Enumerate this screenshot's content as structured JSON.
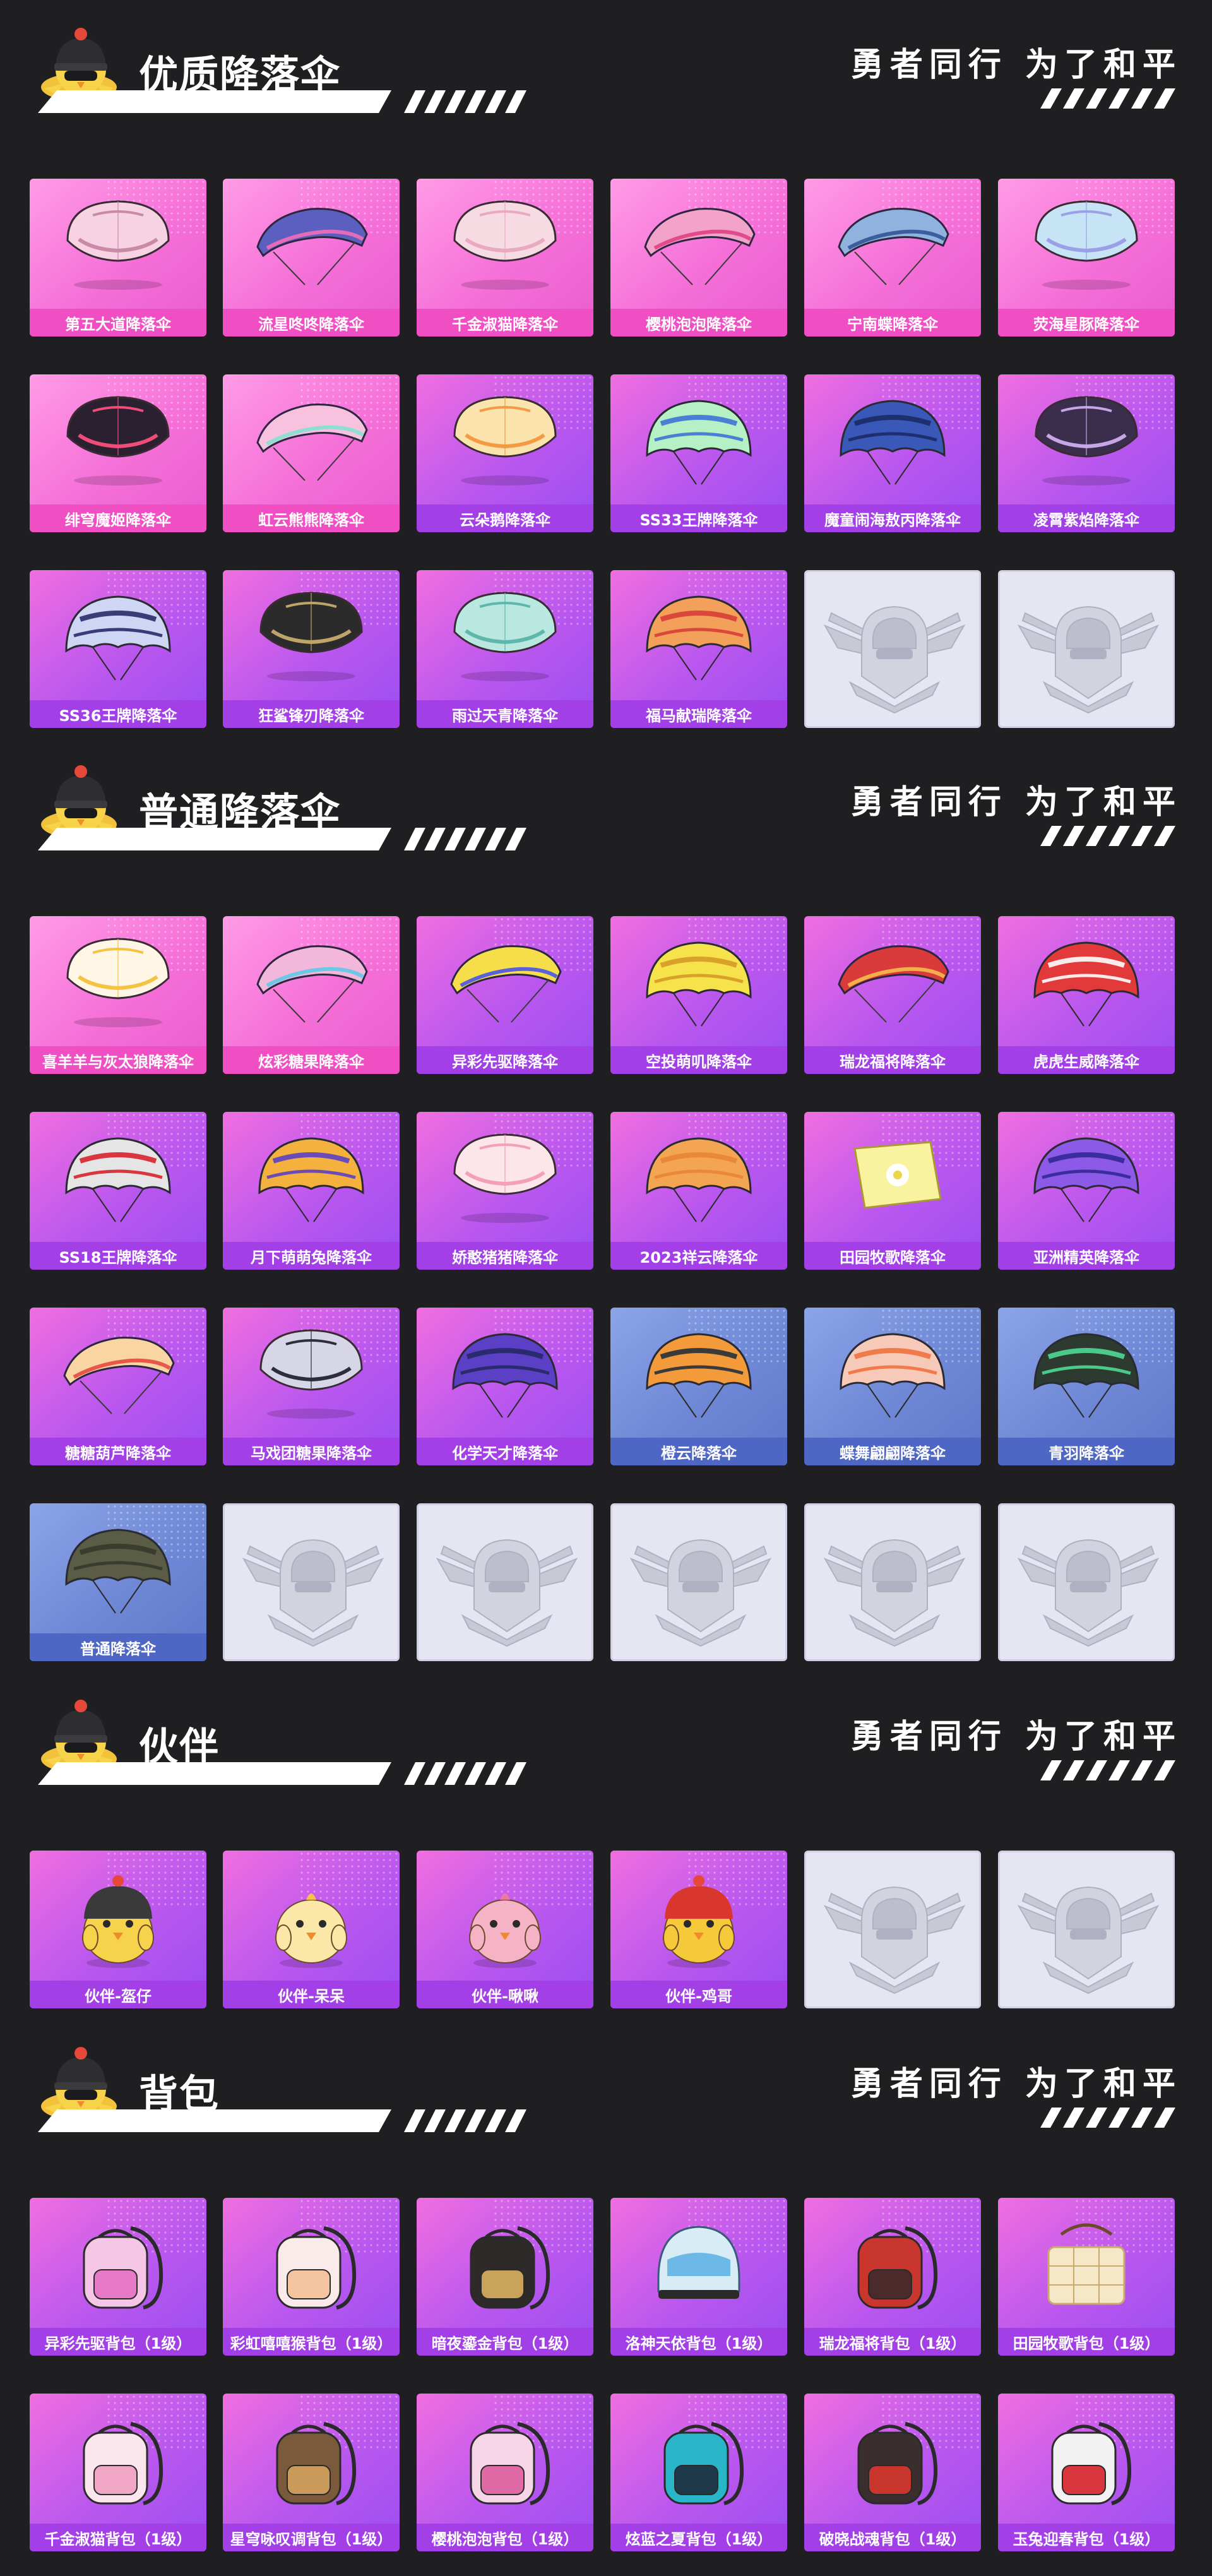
{
  "slogan": "勇者同行 为了和平",
  "sections": [
    {
      "title": "优质降落伞",
      "items": [
        {
          "label": "第五大道降落伞",
          "tier": "pink",
          "kind": "parachute-round",
          "c1": "#f6d2e2",
          "c2": "#c98aa8"
        },
        {
          "label": "流星咚咚降落伞",
          "tier": "pink",
          "kind": "parachute-wing",
          "c1": "#5b5fbf",
          "c2": "#e56bb9"
        },
        {
          "label": "千金淑猫降落伞",
          "tier": "pink",
          "kind": "parachute-round",
          "c1": "#f7dbe3",
          "c2": "#e9a9c0"
        },
        {
          "label": "樱桃泡泡降落伞",
          "tier": "pink",
          "kind": "parachute-wing",
          "c1": "#f3a3c9",
          "c2": "#e14b8b"
        },
        {
          "label": "宁南蝶降落伞",
          "tier": "pink",
          "kind": "parachute-wing",
          "c1": "#8fb3de",
          "c2": "#3d5e9c"
        },
        {
          "label": "荧海星豚降落伞",
          "tier": "pink",
          "kind": "parachute-round",
          "c1": "#c7e3f6",
          "c2": "#9a9fe6"
        },
        {
          "label": "绯穹魔姬降落伞",
          "tier": "pink",
          "kind": "parachute-round",
          "c1": "#2b2030",
          "c2": "#ef4d78"
        },
        {
          "label": "虹云熊熊降落伞",
          "tier": "pink",
          "kind": "parachute-wing",
          "c1": "#f8c2de",
          "c2": "#8edfd3"
        },
        {
          "label": "云朵鹅降落伞",
          "tier": "purple",
          "kind": "parachute-round",
          "c1": "#fbe3ae",
          "c2": "#f49a44"
        },
        {
          "label": "SS33王牌降落伞",
          "tier": "purple",
          "kind": "parachute-dome",
          "c1": "#b5f1c4",
          "c2": "#4b7fd6"
        },
        {
          "label": "魔童闹海敖丙降落伞",
          "tier": "purple",
          "kind": "parachute-dome",
          "c1": "#3a58b8",
          "c2": "#1f2e6e"
        },
        {
          "label": "凌霄紫焰降落伞",
          "tier": "purple",
          "kind": "parachute-round",
          "c1": "#3a2e4c",
          "c2": "#c6a6e6"
        },
        {
          "label": "SS36王牌降落伞",
          "tier": "purple",
          "kind": "parachute-dome",
          "c1": "#cfd6f3",
          "c2": "#3a3c78"
        },
        {
          "label": "狂鲨锋刃降落伞",
          "tier": "purple",
          "kind": "parachute-round",
          "c1": "#2b2b2b",
          "c2": "#bfa46a"
        },
        {
          "label": "雨过天青降落伞",
          "tier": "purple",
          "kind": "parachute-round",
          "c1": "#b8e8e0",
          "c2": "#5fb6ad"
        },
        {
          "label": "福马献瑞降落伞",
          "tier": "purple",
          "kind": "parachute-dome",
          "c1": "#f2a05a",
          "c2": "#d9483a"
        },
        {
          "label": "",
          "tier": "empty",
          "kind": "emblem"
        },
        {
          "label": "",
          "tier": "empty",
          "kind": "emblem"
        }
      ]
    },
    {
      "title": "普通降落伞",
      "items": [
        {
          "label": "喜羊羊与灰太狼降落伞",
          "tier": "pink",
          "kind": "parachute-round",
          "c1": "#fff6e6",
          "c2": "#f4c343"
        },
        {
          "label": "炫彩糖果降落伞",
          "tier": "pink",
          "kind": "parachute-wing",
          "c1": "#f2b7da",
          "c2": "#6cc8e6"
        },
        {
          "label": "异彩先驱降落伞",
          "tier": "purple",
          "kind": "parachute-wing",
          "c1": "#f6de4b",
          "c2": "#5b61d8"
        },
        {
          "label": "空投萌叽降落伞",
          "tier": "purple",
          "kind": "parachute-dome",
          "c1": "#f6e24a",
          "c2": "#d9a12a"
        },
        {
          "label": "瑞龙福将降落伞",
          "tier": "purple",
          "kind": "parachute-wing",
          "c1": "#d93a3a",
          "c2": "#f2b04a"
        },
        {
          "label": "虎虎生威降落伞",
          "tier": "purple",
          "kind": "parachute-dome",
          "c1": "#e23a3a",
          "c2": "#fbeaea"
        },
        {
          "label": "SS18王牌降落伞",
          "tier": "purple",
          "kind": "parachute-dome",
          "c1": "#e5e5e5",
          "c2": "#d9363e"
        },
        {
          "label": "月下萌萌兔降落伞",
          "tier": "purple",
          "kind": "parachute-dome",
          "c1": "#f4b13e",
          "c2": "#6b4bb8"
        },
        {
          "label": "娇憨猪猪降落伞",
          "tier": "purple",
          "kind": "parachute-round",
          "c1": "#fde6ea",
          "c2": "#f3a0b5"
        },
        {
          "label": "2023祥云降落伞",
          "tier": "purple",
          "kind": "parachute-dome",
          "c1": "#f4a552",
          "c2": "#e88838"
        },
        {
          "label": "田园牧歌降落伞",
          "tier": "purple",
          "kind": "parachute-square",
          "c1": "#f9f3a0",
          "c2": "#e9d64a"
        },
        {
          "label": "亚洲精英降落伞",
          "tier": "purple",
          "kind": "parachute-dome",
          "c1": "#8c5ae6",
          "c2": "#3b2d9e"
        },
        {
          "label": "糖糖葫芦降落伞",
          "tier": "purple",
          "kind": "parachute-wing",
          "c1": "#f9d5a3",
          "c2": "#e8574a"
        },
        {
          "label": "马戏团糖果降落伞",
          "tier": "purple",
          "kind": "parachute-round",
          "c1": "#d6d6e6",
          "c2": "#2e2e3a"
        },
        {
          "label": "化学天才降落伞",
          "tier": "purple",
          "kind": "parachute-dome",
          "c1": "#5b3fc4",
          "c2": "#2a2a6e"
        },
        {
          "label": "橙云降落伞",
          "tier": "blue",
          "kind": "parachute-dome",
          "c1": "#f39a3a",
          "c2": "#3a3a3a"
        },
        {
          "label": "蝶舞翩翩降落伞",
          "tier": "blue",
          "kind": "parachute-dome",
          "c1": "#f7c9b8",
          "c2": "#f07a4a"
        },
        {
          "label": "青羽降落伞",
          "tier": "blue",
          "kind": "parachute-dome",
          "c1": "#2c3a30",
          "c2": "#4bc98a"
        },
        {
          "label": "普通降落伞",
          "tier": "blue",
          "kind": "parachute-dome",
          "c1": "#5a5c45",
          "c2": "#3a3c2e"
        },
        {
          "label": "",
          "tier": "empty",
          "kind": "emblem"
        },
        {
          "label": "",
          "tier": "empty",
          "kind": "emblem"
        },
        {
          "label": "",
          "tier": "empty",
          "kind": "emblem"
        },
        {
          "label": "",
          "tier": "empty",
          "kind": "emblem"
        },
        {
          "label": "",
          "tier": "empty",
          "kind": "emblem"
        }
      ]
    },
    {
      "title": "伙伴",
      "items": [
        {
          "label": "伙伴-盔仔",
          "tier": "purple",
          "kind": "chick-helmet",
          "c1": "#f6d34a",
          "c2": "#3a3a3a"
        },
        {
          "label": "伙伴-呆呆",
          "tier": "purple",
          "kind": "chick",
          "c1": "#fbe8a8",
          "c2": "#f4c34a"
        },
        {
          "label": "伙伴-啾啾",
          "tier": "purple",
          "kind": "chick",
          "c1": "#f6b3c6",
          "c2": "#e87aa0"
        },
        {
          "label": "伙伴-鸡哥",
          "tier": "purple",
          "kind": "chick-helmet",
          "c1": "#f6c93a",
          "c2": "#d9362e"
        },
        {
          "label": "",
          "tier": "empty",
          "kind": "emblem"
        },
        {
          "label": "",
          "tier": "empty",
          "kind": "emblem"
        }
      ]
    },
    {
      "title": "背包",
      "items": [
        {
          "label": "异彩先驱背包（1级）",
          "tier": "purple",
          "kind": "backpack",
          "c1": "#f6c6e6",
          "c2": "#e879c8"
        },
        {
          "label": "彩虹嘻嘻猴背包（1级）",
          "tier": "purple",
          "kind": "backpack",
          "c1": "#fbeaea",
          "c2": "#f4c3a0"
        },
        {
          "label": "暗夜鎏金背包（1级）",
          "tier": "purple",
          "kind": "backpack",
          "c1": "#2e2a2a",
          "c2": "#c9a35a"
        },
        {
          "label": "洛神天依背包（1级）",
          "tier": "purple",
          "kind": "helmet",
          "c1": "#d8ecf6",
          "c2": "#6cb8e6"
        },
        {
          "label": "瑞龙福将背包（1级）",
          "tier": "purple",
          "kind": "backpack",
          "c1": "#c9362e",
          "c2": "#4a2a2a"
        },
        {
          "label": "田园牧歌背包（1级）",
          "tier": "purple",
          "kind": "basket",
          "c1": "#f4e8c8",
          "c2": "#c9a86a"
        },
        {
          "label": "千金淑猫背包（1级）",
          "tier": "purple",
          "kind": "backpack",
          "c1": "#fbe6ee",
          "c2": "#f0a6c4"
        },
        {
          "label": "星穹咏叹调背包（1级）",
          "tier": "purple",
          "kind": "backpack",
          "c1": "#7a5a3a",
          "c2": "#c99a5a"
        },
        {
          "label": "樱桃泡泡背包（1级）",
          "tier": "purple",
          "kind": "backpack",
          "c1": "#f6d6e6",
          "c2": "#e06aa6"
        },
        {
          "label": "炫蓝之夏背包（1级）",
          "tier": "purple",
          "kind": "backpack",
          "c1": "#2ab6c9",
          "c2": "#1e3a4a"
        },
        {
          "label": "破晓战魂背包（1级）",
          "tier": "purple",
          "kind": "backpack",
          "c1": "#3a2e2e",
          "c2": "#c9362e"
        },
        {
          "label": "玉兔迎春背包（1级）",
          "tier": "purple",
          "kind": "backpack",
          "c1": "#f2f2f2",
          "c2": "#d9363e"
        }
      ]
    }
  ]
}
